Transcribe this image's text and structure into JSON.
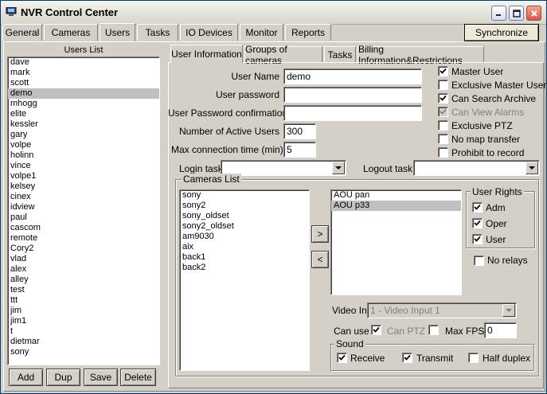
{
  "window": {
    "title": "NVR Control Center"
  },
  "top_tabs": [
    {
      "label": "General"
    },
    {
      "label": "Cameras"
    },
    {
      "label": "Users"
    },
    {
      "label": "Tasks"
    },
    {
      "label": "IO Devices"
    },
    {
      "label": "Monitor"
    },
    {
      "label": "Reports"
    }
  ],
  "synchronize_label": "Synchronize",
  "users_panel": {
    "title": "Users List",
    "users": [
      "dave",
      "mark",
      "scott",
      "demo",
      "mhogg",
      "elite",
      "kessler",
      "gary",
      "volpe",
      "holinn",
      "vince",
      "volpe1",
      "kelsey",
      "cinex",
      "idview",
      "paul",
      "cascom",
      "remote",
      "Cory2",
      "vlad",
      "alex",
      "alley",
      "test",
      "ttt",
      "jim",
      "jim1",
      "t",
      "dietmar",
      "sony"
    ],
    "selected": "demo",
    "buttons": {
      "add": "Add",
      "dup": "Dup",
      "save": "Save",
      "delete": "Delete"
    }
  },
  "sub_tabs": [
    {
      "label": "User Information"
    },
    {
      "label": "Groups of cameras"
    },
    {
      "label": "Tasks"
    },
    {
      "label": "Billing Information&Restrictions"
    }
  ],
  "user_info": {
    "user_name_label": "User Name",
    "user_name_value": "demo",
    "password_label": "User password",
    "password_value": "",
    "confirm_label": "User Password confirmation",
    "confirm_value": "",
    "active_users_label": "Number of Active Users",
    "active_users_value": "300",
    "max_time_label": "Max  connection time (min)",
    "max_time_value": "5",
    "login_task_label": "Login task",
    "login_task_value": "",
    "logout_task_label": "Logout task",
    "logout_task_value": ""
  },
  "flags": [
    {
      "label": "Master User",
      "checked": true,
      "disabled": false
    },
    {
      "label": "Exclusive Master User",
      "checked": false,
      "disabled": false
    },
    {
      "label": "Can Search Archive",
      "checked": true,
      "disabled": false
    },
    {
      "label": "Can View Alarms",
      "checked": true,
      "disabled": true
    },
    {
      "label": "Exclusive PTZ",
      "checked": false,
      "disabled": false
    },
    {
      "label": "No map transfer",
      "checked": false,
      "disabled": false
    },
    {
      "label": "Prohibit to record",
      "checked": false,
      "disabled": false
    }
  ],
  "cameras": {
    "group_title": "Cameras List",
    "available": [
      "sony",
      "sony2",
      "sony_oldset",
      "sony2_oldset",
      "am9030",
      "aix",
      "back1",
      "back2"
    ],
    "assigned": [
      "AOU pan",
      "AOU p33"
    ],
    "assigned_selected": "AOU p33",
    "add_arrow": ">",
    "remove_arrow": "<"
  },
  "user_rights": {
    "title": "User Rights",
    "items": [
      {
        "label": "Adm",
        "checked": true
      },
      {
        "label": "Oper",
        "checked": true
      },
      {
        "label": "User",
        "checked": true
      }
    ],
    "no_relays_label": "No relays",
    "no_relays_checked": false
  },
  "video": {
    "video_in_label": "Video In:",
    "video_in_value": "1 - Video Input 1",
    "can_use_label": "Can use",
    "can_use_checked": true,
    "can_ptz_label": "Can PTZ",
    "can_ptz_checked": false,
    "max_fps_label": "Max FPS:",
    "max_fps_value": "0"
  },
  "sound": {
    "title": "Sound",
    "receive_label": "Receive",
    "receive_checked": true,
    "transmit_label": "Transmit",
    "transmit_checked": true,
    "half_duplex_label": "Half duplex",
    "half_duplex_checked": false
  }
}
